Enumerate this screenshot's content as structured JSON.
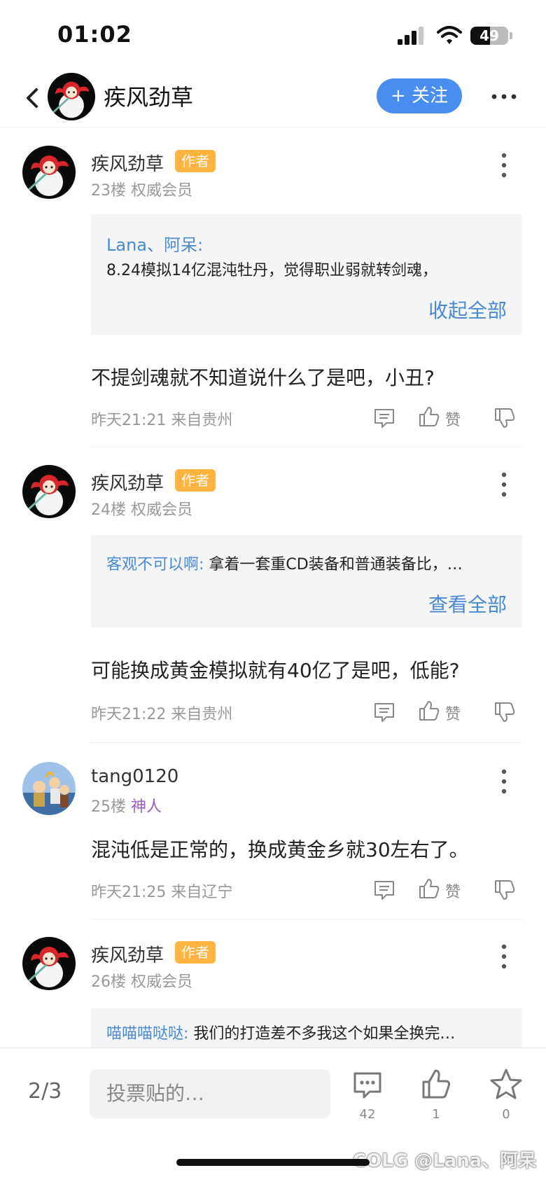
{
  "status": {
    "time": "01:02",
    "battery": "49"
  },
  "header": {
    "title": "疾风劲草",
    "follow_label": "+ 关注"
  },
  "posts": [
    {
      "user": "疾风劲草",
      "badge": "作者",
      "floor": "23楼",
      "rank": "权威会员",
      "quote_name": "Lana、阿呆:",
      "quote_text": "8.24模拟14亿混沌牡丹，觉得职业弱就转剑魂，",
      "expand": "收起全部",
      "content": "不提剑魂就不知道说什么了是吧，小丑?",
      "time": "昨天21:21",
      "from": "来自贵州",
      "like_label": "赞"
    },
    {
      "user": "疾风劲草",
      "badge": "作者",
      "floor": "24楼",
      "rank": "权威会员",
      "quote_name": "客观不可以啊:",
      "quote_text": "拿着一套重CD装备和普通装备比，…",
      "expand": "查看全部",
      "content": "可能换成黄金模拟就有40亿了是吧，低能?",
      "time": "昨天21:22",
      "from": "来自贵州",
      "like_label": "赞"
    },
    {
      "user": "tang0120",
      "floor": "25楼",
      "rank": "神人",
      "content": "混沌低是正常的，换成黄金乡就30左右了。",
      "time": "昨天21:25",
      "from": "来自辽宁",
      "like_label": "赞"
    },
    {
      "user": "疾风劲草",
      "badge": "作者",
      "floor": "26楼",
      "rank": "权威会员",
      "quote_name": "喵喵喵哒哒:",
      "quote_text": "我们的打造差不多我这个如果全换完…"
    }
  ],
  "bottom": {
    "page": "2/3",
    "input_placeholder": "投票贴的…",
    "comment_count": "42",
    "like_count": "1",
    "fav_count": "0",
    "watermark": "COLG @Lana、阿呆"
  },
  "colors": {
    "accent": "#4a8df0",
    "badge": "#ffb340",
    "link": "#4a8ad4",
    "god_rank": "#9b59c6"
  }
}
